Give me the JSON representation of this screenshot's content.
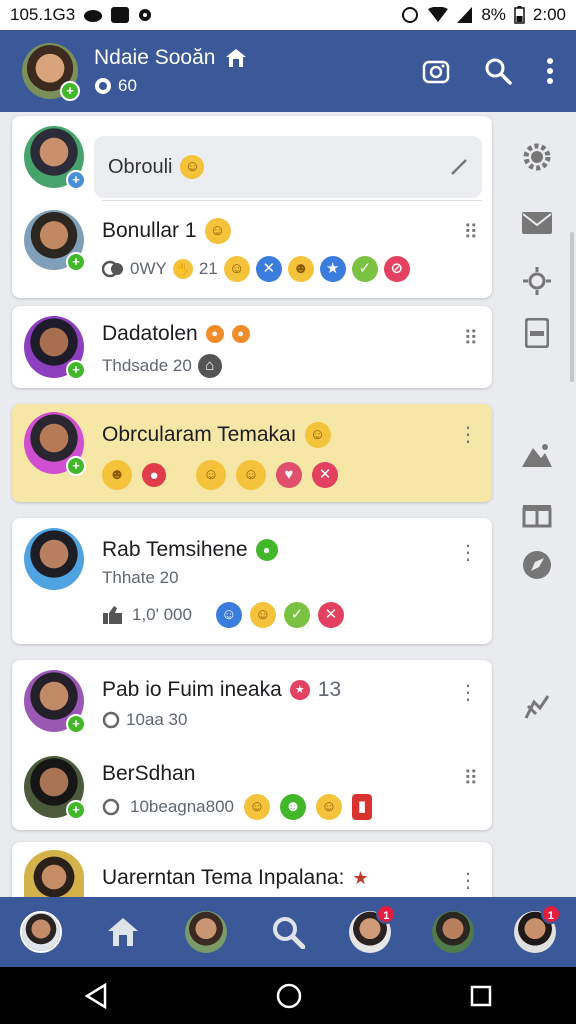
{
  "status_bar": {
    "time_left": "105.1G3",
    "battery": "8%",
    "clock": "2:00"
  },
  "header": {
    "title": "Ndaie Sooăn",
    "subtitle_count": "60"
  },
  "composer": {
    "placeholder": "Obrouli"
  },
  "posts": [
    {
      "name": "Bonullar 1",
      "meta": "0WY",
      "meta2": "21"
    },
    {
      "name": "Dadatolen",
      "meta": "Thdsade 20"
    },
    {
      "name": "Obrcularam Temakaı"
    },
    {
      "name": "Rab Temsihene",
      "meta": "Thhate 20",
      "meta2": "1,0' 000"
    },
    {
      "name": "Pab io Fuim ineaka",
      "name_suffix": "13",
      "meta": "10aa 30"
    },
    {
      "name": "BerSdhan",
      "meta": "10beagna800"
    },
    {
      "name": "Uarerntan Tema Inpalana:"
    }
  ],
  "icons": {
    "header": [
      "camera-icon",
      "search-icon",
      "more-vertical-icon"
    ],
    "rail": [
      "gear-icon",
      "mail-icon",
      "sun-icon",
      "sim-icon",
      "mountain-icon",
      "gift-icon",
      "compass-icon",
      "link-icon"
    ],
    "tabs": [
      "profile-tab-icon",
      "home-icon",
      "friend-tab-icon",
      "search-tab-icon",
      "messages-tab-icon",
      "groups-tab-icon",
      "notifications-tab-icon"
    ]
  },
  "colors": {
    "brand": "#3b5998",
    "highlight": "#f6e7a7",
    "badge": "#42b72a",
    "notification": "#e41e3f"
  }
}
